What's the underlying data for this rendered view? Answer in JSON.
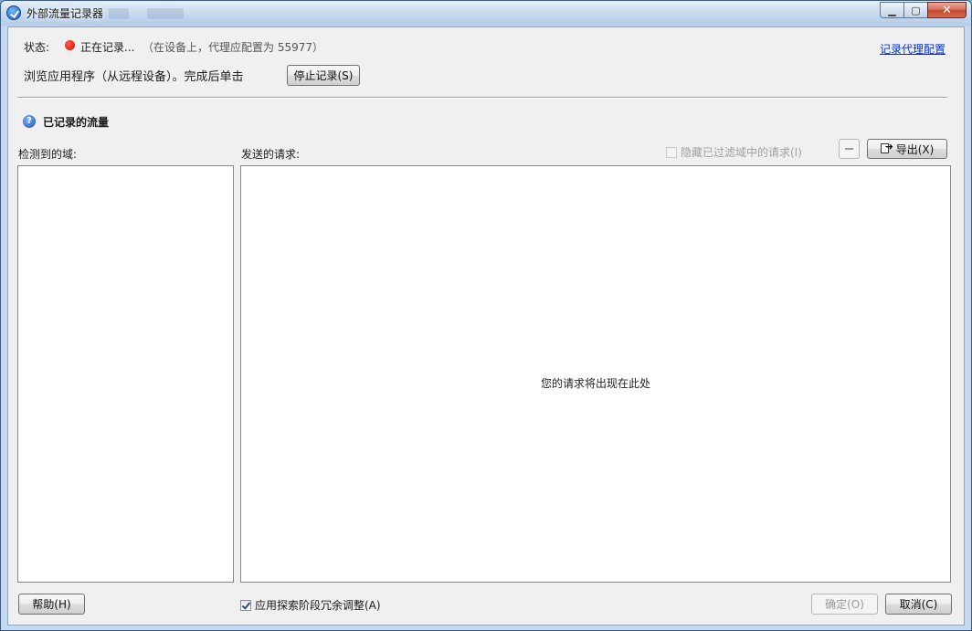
{
  "window": {
    "title": "外部流量记录器",
    "controls": {
      "minimize": "▁",
      "maximize": "▢",
      "close": "✕"
    }
  },
  "status": {
    "label": "状态:",
    "value": "正在记录...",
    "detail": "（在设备上，代理应配置为 55977）",
    "indicator_color": "#e00b00"
  },
  "instruction": "浏览应用程序（从远程设备）。完成后单击",
  "stop_button": "停止记录(S)",
  "proxy_config_link": "记录代理配置",
  "section": {
    "title": "已记录的流量",
    "icon": "help-icon"
  },
  "domains_panel": {
    "label": "检测到的域:"
  },
  "requests_panel": {
    "label": "发送的请求:",
    "hide_filtered_checkbox": "隐藏已过滤域中的请求(I)",
    "hide_filtered_checked": false,
    "remove_button_icon": "minus-icon",
    "export_button": "导出(X)",
    "placeholder": "您的请求将出现在此处"
  },
  "footer": {
    "help_button": "帮助(H)",
    "apply_checkbox": "应用探索阶段冗余调整(A)",
    "apply_checked": true,
    "ok_button": "确定(O)",
    "cancel_button": "取消(C)"
  }
}
